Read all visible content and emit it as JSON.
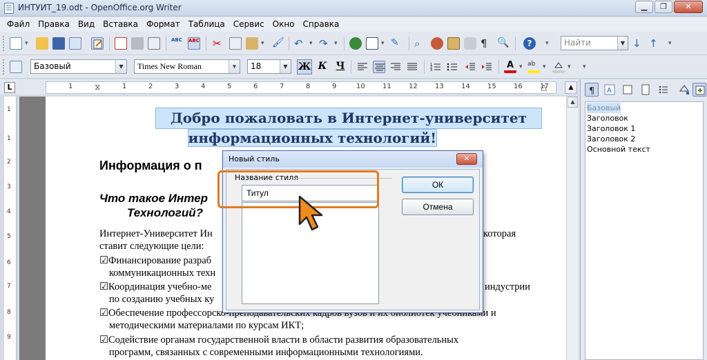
{
  "window": {
    "title": "ИНТУИТ_19.odt - OpenOffice.org Writer",
    "buttons": {
      "minimize": "▁",
      "maximize": "❐",
      "close": "✕"
    }
  },
  "menu": [
    "Файл",
    "Правка",
    "Вид",
    "Вставка",
    "Формат",
    "Таблица",
    "Сервис",
    "Окно",
    "Справка"
  ],
  "toolbar": {
    "find_placeholder": "Найти"
  },
  "formatting": {
    "paragraph_style": "Базовый",
    "font_name": "Times New Roman",
    "font_size": "18",
    "bold": "Ж",
    "italic": "К",
    "underline": "Ч"
  },
  "ruler": {
    "labels": [
      "1",
      "1",
      "2",
      "3",
      "4",
      "5",
      "6",
      "7",
      "8",
      "9",
      "10",
      "11",
      "12",
      "13",
      "14",
      "15",
      "16",
      "17"
    ],
    "vertical_labels": [
      "1",
      "1",
      "2",
      "3",
      "4",
      "5",
      "6",
      "7",
      "8",
      "9",
      "10"
    ],
    "corner": "L"
  },
  "document": {
    "title_line1": "Добро пожаловать в Интернет-университет",
    "title_line2": "информационных технологий!",
    "h2": "Информация о п",
    "h3_line1": "Что такое Интер",
    "h3_line2": "Технологий?",
    "p1_left": "Интернет-Университет Ин",
    "p1_right": "которая",
    "p1_line2": "ставит следующие цели:",
    "li1_left": "☑Финансирование разраб",
    "li1_line2": "коммуникационных техн",
    "li2_left": "☑Координация учебно-ме",
    "li2_right": "индустрии",
    "li2_line2": "по созданию учебных ку",
    "li3_line1": "☑Обеспечение профессорско-преподавательских кадров вузов и их библиотек учебниками и",
    "li3_line2": "методическими материалами по курсам ИКТ;",
    "li4_line1": "☑Содействие органам государственной власти в области развития образовательных",
    "li4_line2": "программ, связанных с современными информационными технологиями."
  },
  "styles_panel": {
    "items": [
      "Базовый",
      "Заголовок",
      "Заголовок 1",
      "Заголовок 2",
      "Основной текст"
    ],
    "selected": "Базовый"
  },
  "dialog": {
    "title": "Новый стиль",
    "group_label": "Название стиля",
    "style_name_value": "Титул",
    "ok_label": "ОК",
    "cancel_label": "Отмена",
    "close_glyph": "✕"
  }
}
